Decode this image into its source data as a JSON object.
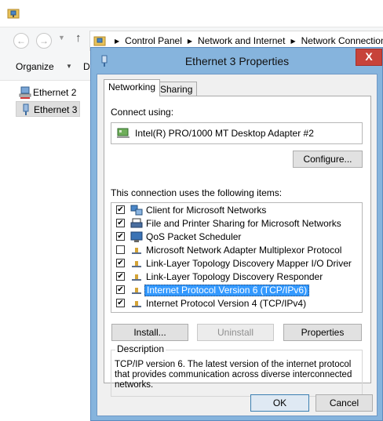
{
  "explorer": {
    "breadcrumb": [
      "Control Panel",
      "Network and Internet",
      "Network Connections"
    ],
    "toolbar": {
      "organize_label": "Organize",
      "disable_label": "D"
    },
    "connections": [
      "Ethernet 2",
      "Ethernet 3"
    ]
  },
  "dialog": {
    "title": "Ethernet 3 Properties",
    "close_glyph": "X",
    "tabs": [
      "Networking",
      "Sharing"
    ],
    "connect_using_label": "Connect using:",
    "adapter_name": "Intel(R) PRO/1000 MT Desktop Adapter #2",
    "configure_label": "Configure...",
    "items_label": "This connection uses the following items:",
    "items": [
      {
        "label": "Client for Microsoft Networks",
        "checked": true,
        "icon": "client-icon"
      },
      {
        "label": "File and Printer Sharing for Microsoft Networks",
        "checked": true,
        "icon": "printer-icon"
      },
      {
        "label": "QoS Packet Scheduler",
        "checked": true,
        "icon": "scheduler-icon"
      },
      {
        "label": "Microsoft Network Adapter Multiplexor Protocol",
        "checked": false,
        "icon": "protocol-icon"
      },
      {
        "label": "Link-Layer Topology Discovery Mapper I/O Driver",
        "checked": true,
        "icon": "protocol-icon"
      },
      {
        "label": "Link-Layer Topology Discovery Responder",
        "checked": true,
        "icon": "protocol-icon"
      },
      {
        "label": "Internet Protocol Version 6 (TCP/IPv6)",
        "checked": true,
        "icon": "protocol-icon",
        "selected": true
      },
      {
        "label": "Internet Protocol Version 4 (TCP/IPv4)",
        "checked": true,
        "icon": "protocol-icon"
      }
    ],
    "install_label": "Install...",
    "uninstall_label": "Uninstall",
    "properties_label": "Properties",
    "description_legend": "Description",
    "description_text": "TCP/IP version 6. The latest version of the internet protocol that provides communication across diverse interconnected networks.",
    "ok_label": "OK",
    "cancel_label": "Cancel"
  },
  "colors": {
    "dialog_frame": "#86b4dd",
    "close_button": "#c7433a",
    "selection": "#3399ff"
  }
}
